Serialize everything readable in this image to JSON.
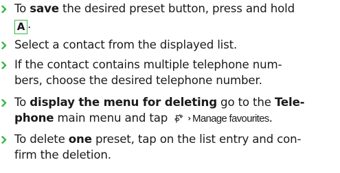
{
  "accent_color": "#3cb44b",
  "steps": [
    {
      "lines": [
        [
          {
            "t": "To "
          },
          {
            "t": "save",
            "b": true
          },
          {
            "t": " the desired preset button, press and hold"
          }
        ],
        [
          {
            "key": "A"
          },
          {
            "t": "."
          }
        ]
      ]
    },
    {
      "lines": [
        [
          {
            "t": "Select a contact from the displayed list."
          }
        ]
      ]
    },
    {
      "lines": [
        [
          {
            "t": "If the contact contains multiple telephone num-"
          }
        ],
        [
          {
            "t": "bers, choose the desired telephone number."
          }
        ]
      ]
    },
    {
      "lines": [
        [
          {
            "t": "To "
          },
          {
            "t": "display the menu for deleting",
            "b": true
          },
          {
            "t": " go to the "
          },
          {
            "t": "Tele-",
            "b": true
          }
        ],
        [
          {
            "t": "phone",
            "b": true
          },
          {
            "t": " main menu and tap "
          },
          {
            "icon": "settings-icon"
          },
          {
            "arrow": "›"
          },
          {
            "menu": "Manage favourites"
          },
          {
            "t": "."
          }
        ]
      ]
    },
    {
      "lines": [
        [
          {
            "t": "To delete "
          },
          {
            "t": "one",
            "b": true
          },
          {
            "t": " preset, tap on the list entry and con-"
          }
        ],
        [
          {
            "t": "firm the deletion."
          }
        ]
      ]
    }
  ]
}
